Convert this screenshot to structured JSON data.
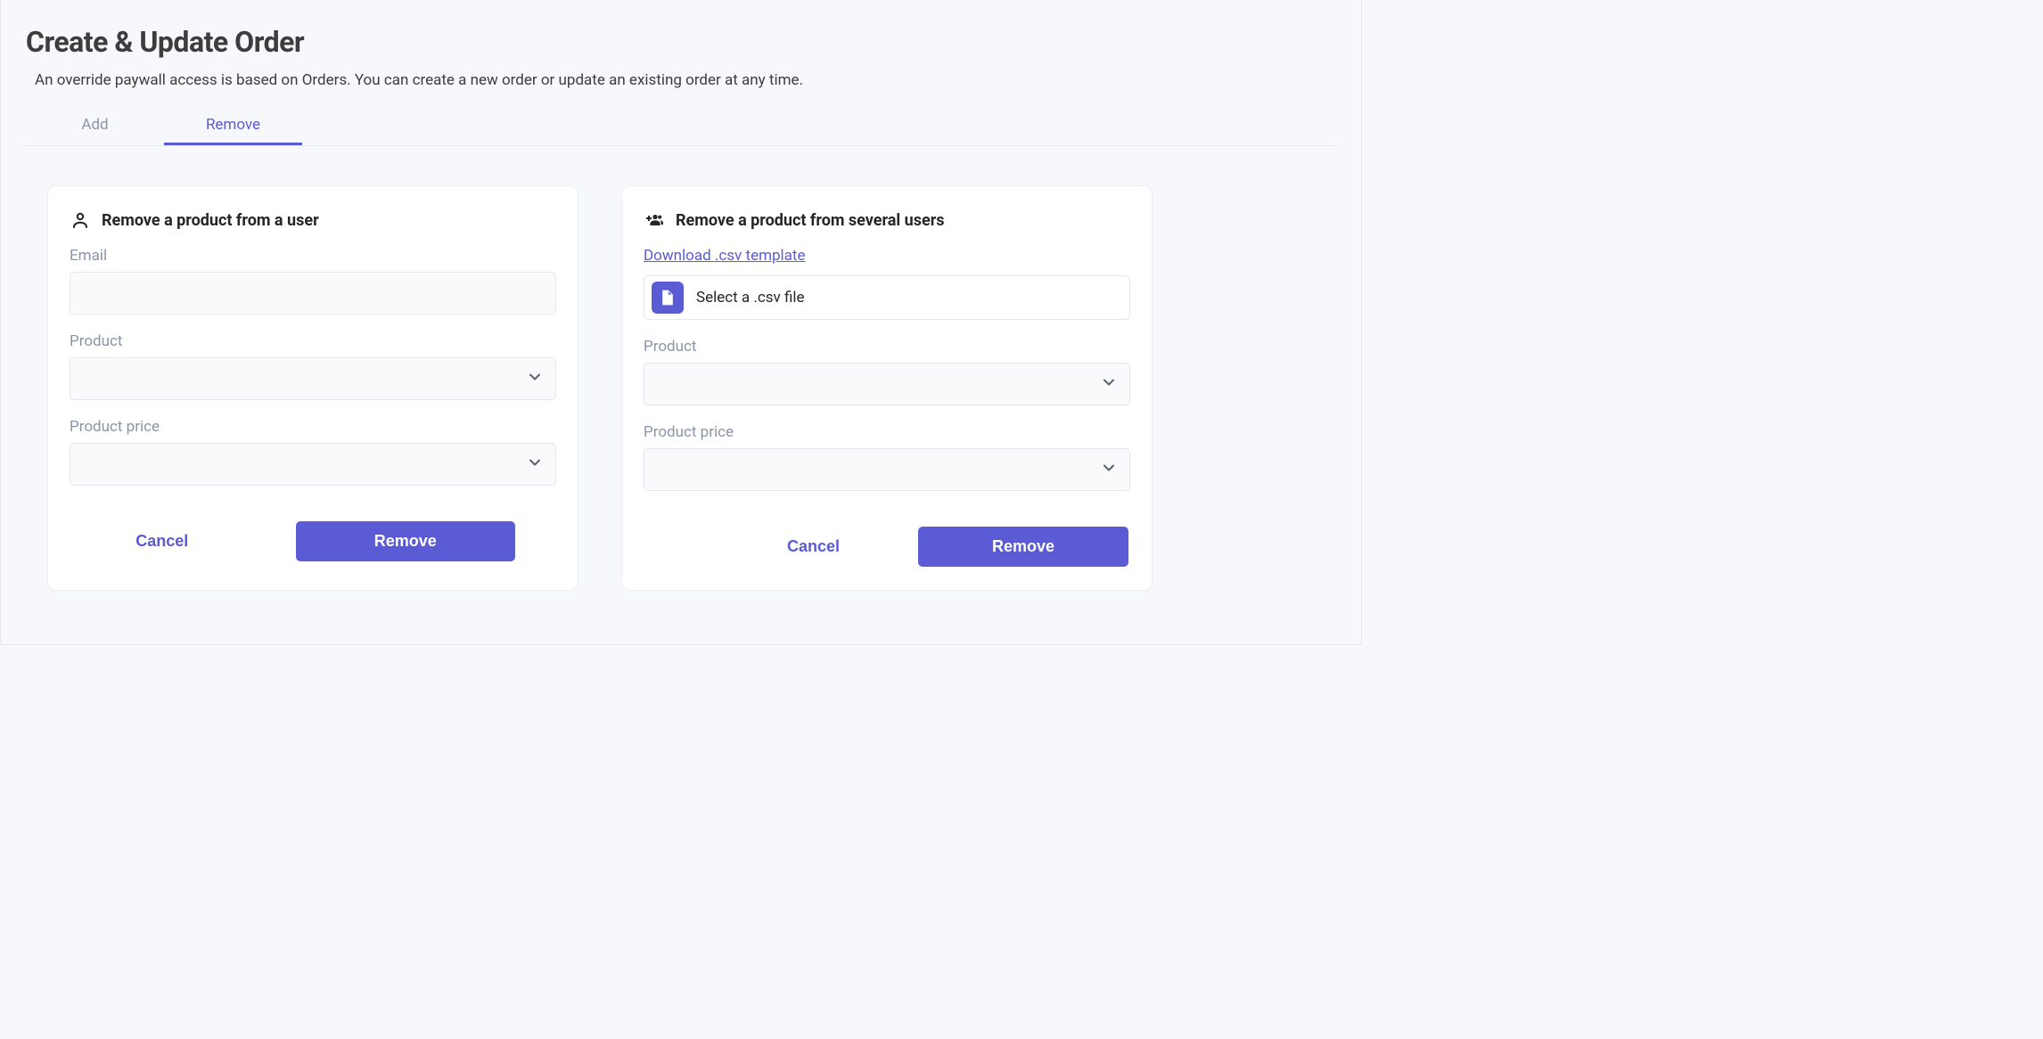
{
  "header": {
    "title": "Create & Update Order",
    "subtitle": "An override paywall access is based on Orders. You can create a new order or update an existing order at any time."
  },
  "tabs": {
    "add_label": "Add",
    "remove_label": "Remove",
    "active": "remove"
  },
  "single": {
    "title": "Remove a product from a user",
    "email_label": "Email",
    "email_value": "",
    "product_label": "Product",
    "product_value": "",
    "price_label": "Product price",
    "price_value": "",
    "cancel_label": "Cancel",
    "submit_label": "Remove"
  },
  "bulk": {
    "title": "Remove a product from several users",
    "download_link_label": "Download .csv template",
    "file_select_label": "Select a .csv file",
    "product_label": "Product",
    "product_value": "",
    "price_label": "Product price",
    "price_value": "",
    "cancel_label": "Cancel",
    "submit_label": "Remove"
  },
  "icons": {
    "person": "person-icon",
    "group_add": "group-add-icon",
    "file": "file-icon",
    "chevron_down": "chevron-down-icon"
  },
  "colors": {
    "accent": "#5b5bd6",
    "muted": "#8b95a7",
    "bg": "#f7f8fb",
    "card": "#ffffff",
    "border": "#e4e6ef",
    "text": "#3d3d3d"
  }
}
